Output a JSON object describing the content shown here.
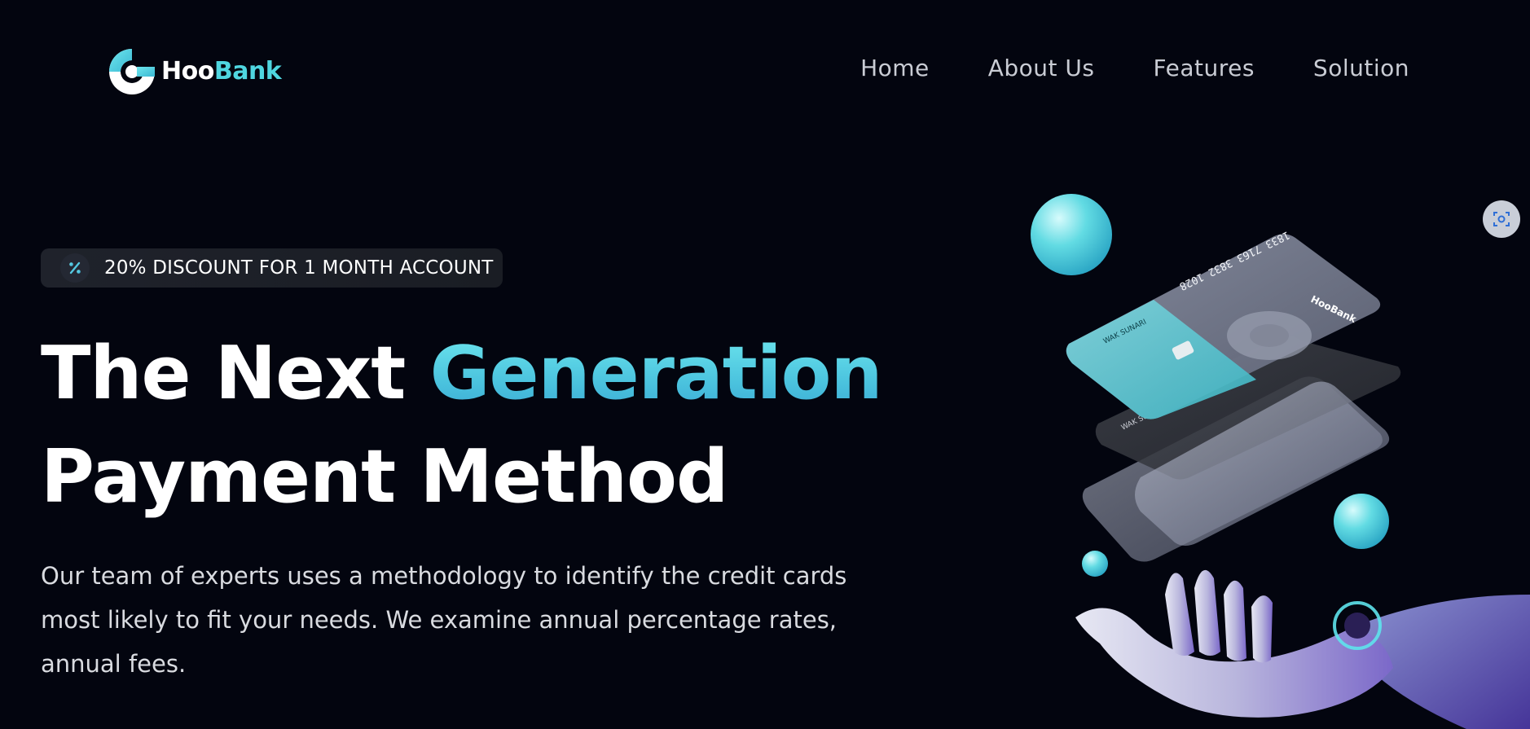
{
  "brand": {
    "name_part1": "Hoo",
    "name_part2": "Bank",
    "accent_color": "#4fd6e0"
  },
  "nav": {
    "items": [
      {
        "label": "Home"
      },
      {
        "label": "About Us"
      },
      {
        "label": "Features"
      },
      {
        "label": "Solution"
      }
    ]
  },
  "hero": {
    "badge": {
      "icon": "discount-icon",
      "text": "20% DISCOUNT FOR 1 MONTH ACCOUNT"
    },
    "headline": {
      "part1": "The Next ",
      "highlight": "Generation",
      "line2": "Payment Method"
    },
    "description": "Our team of experts uses a methodology to identify the credit cards most likely to fit your needs. We examine annual percentage rates, annual fees.",
    "illustration": {
      "card_number": "1833 7163 3832 1028",
      "card_holder": "WAK SUNARI",
      "card_brand": "HooBank"
    }
  },
  "colors": {
    "background": "#03050f",
    "gradient_start": "#6ee7ee",
    "gradient_end": "#3aa9d4",
    "nav_text": "#c9ccd4"
  }
}
